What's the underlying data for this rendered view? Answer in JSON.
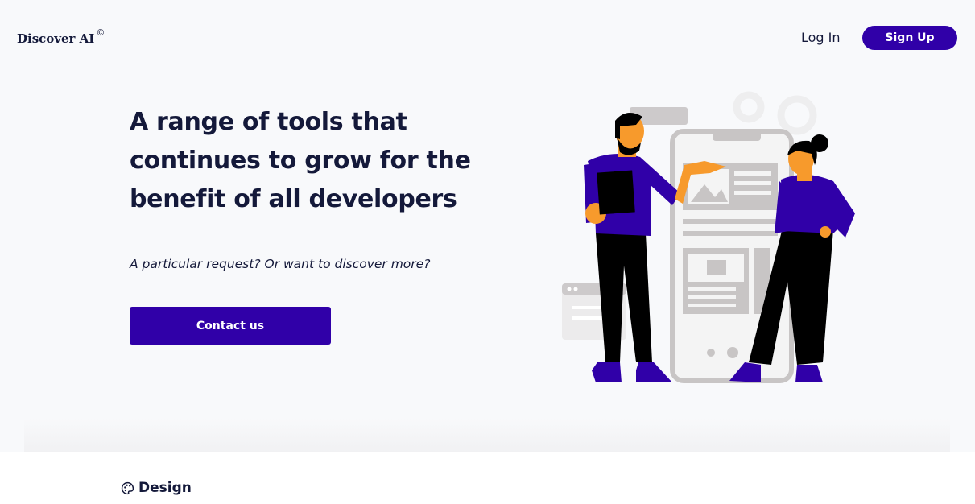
{
  "header": {
    "logo_text": "Discover AI",
    "logo_mark": "©",
    "login_label": "Log In",
    "signup_label": "Sign Up"
  },
  "hero": {
    "headline": "A range of tools that continues to grow for the benefit of all developers",
    "subtext": "A particular request? Or want to discover more?",
    "cta_label": "Contact us",
    "illustration": "two-people-with-phone-mockup-illustration"
  },
  "sections": {
    "first_title": "Design",
    "first_icon": "palette-icon"
  },
  "colors": {
    "accent": "#3000a8",
    "text": "#14193a",
    "hero_bg": "#f8f9fb",
    "skin": "#f79a2c",
    "mockup_gray": "#c8c5c5"
  }
}
